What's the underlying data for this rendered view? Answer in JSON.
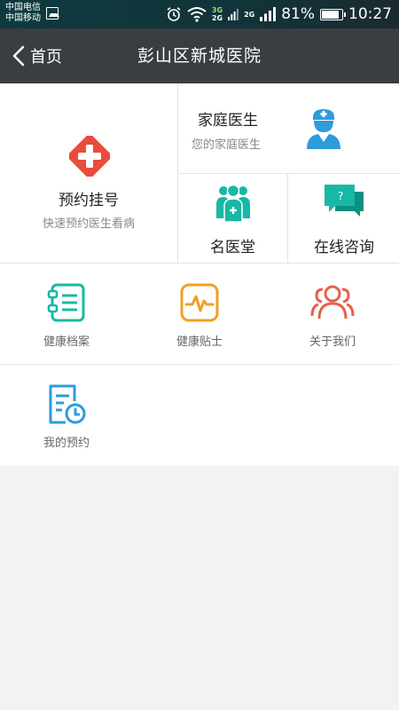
{
  "status_bar": {
    "carrier_1": "中国电信",
    "carrier_2": "中国移动",
    "net_3g": "3G",
    "net_2g_a": "2G",
    "net_2g_b": "2G",
    "battery_percent": "81%",
    "time": "10:27"
  },
  "header": {
    "back_label": "首页",
    "title": "彭山区新城医院"
  },
  "services": {
    "appointment": {
      "title": "预约挂号",
      "subtitle": "快速预约医生看病"
    },
    "family_doctor": {
      "title": "家庭医生",
      "subtitle": "您的家庭医生"
    },
    "famous_doctors": {
      "title": "名医堂"
    },
    "online_consult": {
      "title": "在线咨询"
    }
  },
  "menu": {
    "health_records": "健康档案",
    "health_tips": "健康贴士",
    "about_us": "关于我们",
    "my_appointments": "我的预约"
  },
  "colors": {
    "red": "#e84c3d",
    "teal": "#17b8a6",
    "blue": "#2e9bdb",
    "orange": "#f0a020",
    "coral": "#e8604c",
    "header_bg": "#3a3e43"
  }
}
